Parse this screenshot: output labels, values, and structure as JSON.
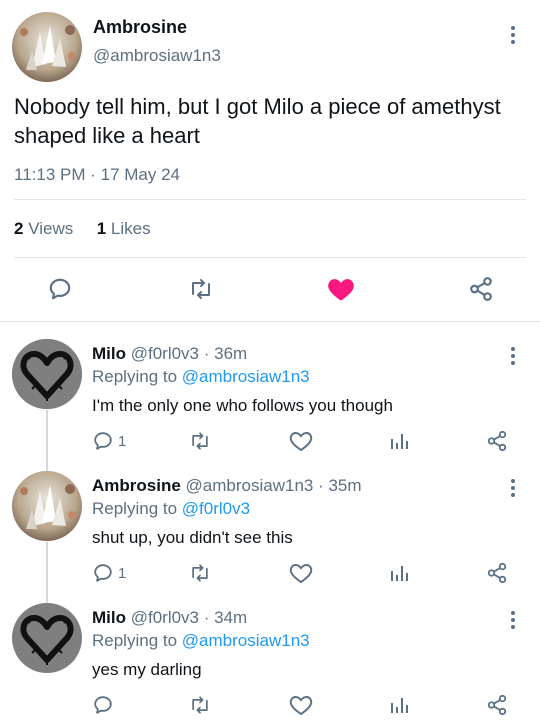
{
  "tweet": {
    "name": "Ambrosine",
    "handle": "@ambrosiaw1n3",
    "text": "Nobody tell him, but I got Milo a piece of amethyst shaped like a heart",
    "time": "11:13 PM · 17 May 24",
    "views_count": "2",
    "views_label": "Views",
    "likes_count": "1",
    "likes_label": "Likes",
    "liked_color": "#f91880"
  },
  "replies": [
    {
      "name": "Milo",
      "meta": "@f0rl0v3 · 36m",
      "replying_prefix": "Replying to",
      "replying_to": "@ambrosiaw1n3",
      "text": "I'm the only one who follows you though",
      "reply_count": "1"
    },
    {
      "name": "Ambrosine",
      "meta": "@ambrosiaw1n3 · 35m",
      "replying_prefix": "Replying to",
      "replying_to": "@f0rl0v3",
      "text": "shut up, you didn't see this",
      "reply_count": "1"
    },
    {
      "name": "Milo",
      "meta": "@f0rl0v3 · 34m",
      "replying_prefix": "Replying to",
      "replying_to": "@ambrosiaw1n3",
      "text": "yes my darling",
      "reply_count": ""
    }
  ],
  "icons": {
    "reply": "speech-bubble-icon",
    "retweet": "retweet-icon",
    "like": "heart-icon",
    "views": "bar-chart-icon",
    "share": "share-icon",
    "more": "more-vertical-icon"
  },
  "colors": {
    "accent": "#1d9bf0",
    "secondary_text": "#5b7083",
    "like": "#f91880"
  }
}
